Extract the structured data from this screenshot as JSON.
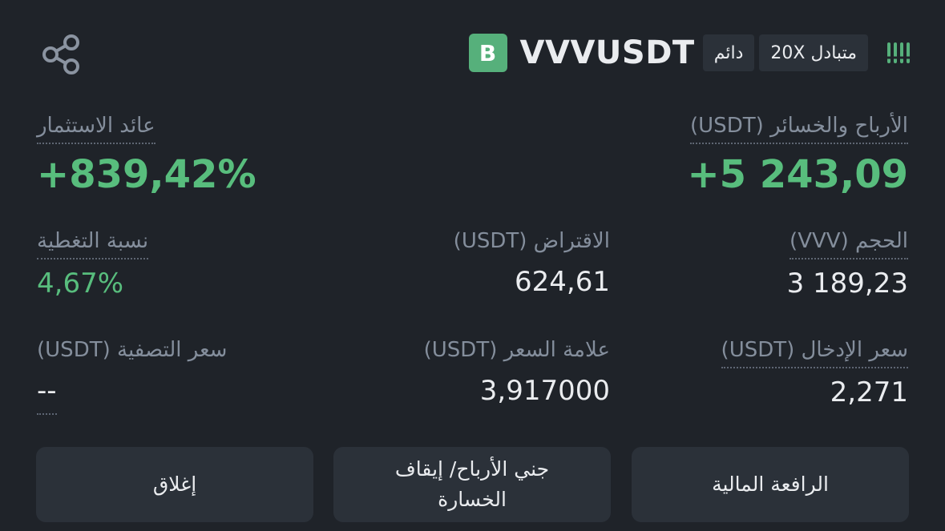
{
  "header": {
    "share_icon": "share-icon",
    "side_badge": "B",
    "symbol": "VVVUSDT",
    "tag_perpetual": "دائم",
    "tag_leverage": "متبادل 20X",
    "signal_icon": "signal-bars-icon",
    "colors": {
      "accent_green": "#58bd7d",
      "badge_green": "#56b07b"
    }
  },
  "metrics": {
    "pnl": {
      "label": "الأرباح والخسائر (USDT)",
      "value": "+5 243,09"
    },
    "roi": {
      "label": "عائد الاستثمار",
      "value": "+839,42%"
    },
    "size": {
      "label": "الحجم (VVV)",
      "value": "3 189,23"
    },
    "margin": {
      "label": "الاقتراض (USDT)",
      "value": "624,61"
    },
    "margin_ratio": {
      "label": "نسبة التغطية",
      "value": "4,67%"
    },
    "entry_price": {
      "label": "سعر الإدخال (USDT)",
      "value": "2,271"
    },
    "mark_price": {
      "label": "علامة السعر (USDT)",
      "value": "3,917000"
    },
    "liq_price": {
      "label": "سعر التصفية (USDT)",
      "value": "--"
    }
  },
  "actions": {
    "leverage": "الرافعة المالية",
    "tp_sl_line1": "جني الأرباح/ إيقاف",
    "tp_sl_line2": "الخسارة",
    "close": "إغلاق"
  }
}
